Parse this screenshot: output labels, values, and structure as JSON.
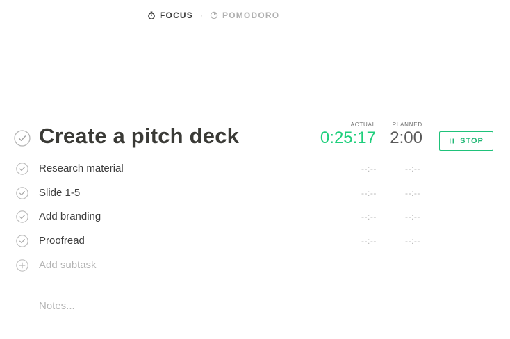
{
  "modes": {
    "focus": {
      "label": "FOCUS",
      "icon": "stopwatch-icon"
    },
    "separator": "·",
    "pomodoro": {
      "label": "POMODORO",
      "icon": "pomodoro-timer-icon"
    }
  },
  "task": {
    "title": "Create a pitch deck",
    "actual_caption": "ACTUAL",
    "planned_caption": "PLANNED",
    "actual_value": "0:25:17",
    "planned_value": "2:00",
    "stop_label": "STOP"
  },
  "subtasks": [
    {
      "label": "Research material",
      "actual": "--:--",
      "planned": "--:--"
    },
    {
      "label": "Slide 1-5",
      "actual": "--:--",
      "planned": "--:--"
    },
    {
      "label": "Add branding",
      "actual": "--:--",
      "planned": "--:--"
    },
    {
      "label": "Proofread",
      "actual": "--:--",
      "planned": "--:--"
    }
  ],
  "add_subtask_label": "Add subtask",
  "notes_placeholder": "Notes...",
  "colors": {
    "accent_green": "#1fcf7c",
    "title": "#3a3a36",
    "muted": "#b3b3b3"
  }
}
